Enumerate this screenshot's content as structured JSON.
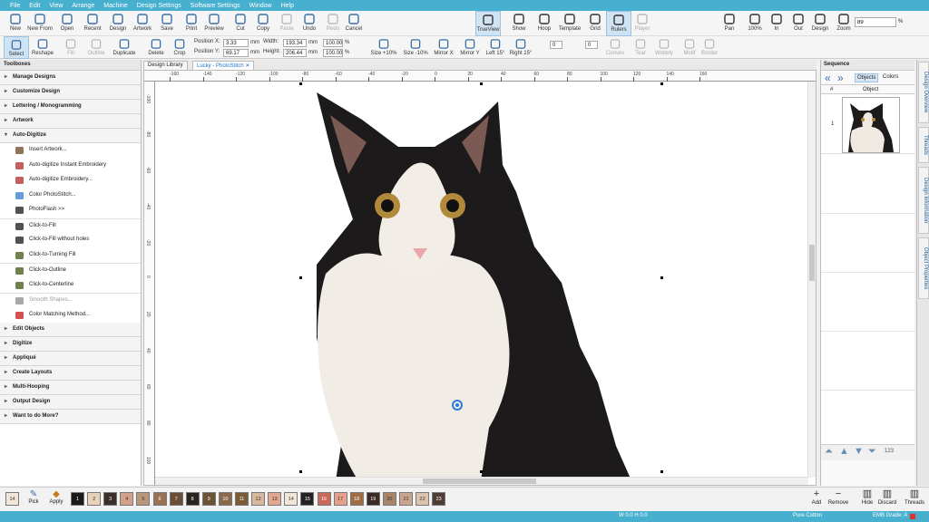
{
  "menu": [
    "File",
    "Edit",
    "View",
    "Arrange",
    "Machine",
    "Design Settings",
    "Software Settings",
    "Window",
    "Help"
  ],
  "toolbar1": {
    "left": [
      {
        "label": "New",
        "icon": "new-file-icon"
      },
      {
        "label": "New From",
        "icon": "new-from-icon"
      },
      {
        "label": "Open",
        "icon": "open-folder-icon"
      },
      {
        "label": "Recent",
        "icon": "recent-icon"
      },
      {
        "label": "Design",
        "icon": "design-icon"
      },
      {
        "label": "Artwork",
        "icon": "artwork-icon"
      },
      {
        "label": "Save",
        "icon": "save-icon"
      },
      {
        "label": "Print",
        "icon": "print-icon"
      },
      {
        "label": "Preview",
        "icon": "preview-icon"
      },
      {
        "label": "Cut",
        "icon": "scissors-icon"
      },
      {
        "label": "Copy",
        "icon": "copy-icon"
      },
      {
        "label": "Paste",
        "icon": "paste-icon"
      },
      {
        "label": "Undo",
        "icon": "undo-icon"
      },
      {
        "label": "Redo",
        "icon": "redo-icon"
      },
      {
        "label": "Cancel",
        "icon": "esc-icon"
      }
    ],
    "center": [
      {
        "label": "TrueView",
        "icon": "eye-icon"
      },
      {
        "label": "Show",
        "icon": "show-icon"
      },
      {
        "label": "Hoop",
        "icon": "hoop-icon"
      },
      {
        "label": "Template",
        "icon": "template-icon"
      },
      {
        "label": "Grid",
        "icon": "grid-icon"
      },
      {
        "label": "Rulers",
        "icon": "rulers-icon"
      },
      {
        "label": "Player",
        "icon": "player-icon"
      }
    ],
    "right": [
      {
        "label": "Pan",
        "icon": "hand-icon"
      },
      {
        "label": "100%",
        "icon": "zoom-100-icon"
      },
      {
        "label": "In",
        "icon": "zoom-in-icon"
      },
      {
        "label": "Out",
        "icon": "zoom-out-icon"
      },
      {
        "label": "Design",
        "icon": "zoom-design-icon"
      },
      {
        "label": "Zoom",
        "icon": "zoom-box-icon"
      }
    ],
    "zoom_value": "89",
    "zoom_unit": "%"
  },
  "toolbar2": {
    "buttons": [
      "Select",
      "Reshape",
      "Fill",
      "Outline",
      "Duplicate",
      "Delete",
      "Crop"
    ],
    "position_x_label": "Position X:",
    "position_x": "3.33",
    "position_y_label": "Position Y:",
    "position_y": "69.17",
    "width_label": "Width:",
    "width": "193.34",
    "height_label": "Height:",
    "height": "206.44",
    "unit": "mm",
    "scale_x": "100.00",
    "scale_y": "100.00",
    "pct": "%",
    "buttons2": [
      "Size +10%",
      "Size -10%",
      "Mirror X",
      "Mirror Y",
      "Left 15°",
      "Right 15°"
    ],
    "rot_a": "0",
    "rot_b": "0",
    "buttons3": [
      "Convex",
      "Tear",
      "Wobbly",
      "Motif",
      "Border"
    ]
  },
  "toolbox": {
    "title": "Toolboxes",
    "sections_top": [
      "Manage Designs",
      "Customize Design",
      "Lettering / Monogramming",
      "Artwork"
    ],
    "open_section": "Auto-Digitize",
    "items": [
      {
        "label": "Insert Artwork...",
        "icon": "insert-artwork-icon",
        "disabled": false
      },
      {
        "label": "Auto-digitize Instant Embroidery",
        "icon": "instant-embroidery-icon",
        "disabled": false
      },
      {
        "label": "Auto-digitize Embroidery...",
        "icon": "auto-digitize-icon",
        "disabled": false
      },
      {
        "label": "Color PhotoStitch...",
        "icon": "photostitch-icon",
        "disabled": false
      },
      {
        "label": "PhotoFlash >>",
        "icon": "camera-icon",
        "disabled": false
      },
      {
        "label": "Click-to-Fill",
        "icon": "click-fill-icon",
        "disabled": false
      },
      {
        "label": "Click-to-Fill without holes",
        "icon": "click-fill-noholes-icon",
        "disabled": false
      },
      {
        "label": "Click-to-Turning Fill",
        "icon": "turning-fill-icon",
        "disabled": false
      },
      {
        "label": "Click-to-Outline",
        "icon": "click-outline-icon",
        "disabled": false
      },
      {
        "label": "Click-to-Centerline",
        "icon": "click-centerline-icon",
        "disabled": false
      },
      {
        "label": "Smooth Shapes...",
        "icon": "smooth-shapes-icon",
        "disabled": true
      },
      {
        "label": "Color Matching Method...",
        "icon": "color-matching-icon",
        "disabled": false
      }
    ],
    "sections_bottom": [
      "Edit Objects",
      "Digitize",
      "Appliqué",
      "Create Layouts",
      "Multi-Hooping",
      "Output Design",
      "Want to do More?"
    ]
  },
  "doc_tabs": [
    "Design Library",
    "Lucky - PhotoStitch"
  ],
  "ruler_top": [
    "-160",
    "-140",
    "-120",
    "-100",
    "-80",
    "-60",
    "-40",
    "-20",
    "0",
    "20",
    "40",
    "60",
    "80",
    "100",
    "120",
    "140",
    "160"
  ],
  "ruler_left": [
    "-100",
    "-80",
    "-60",
    "-40",
    "-20",
    "0",
    "20",
    "40",
    "60",
    "80",
    "100"
  ],
  "sequence": {
    "title": "Sequence",
    "tab_objects": "Objects",
    "tab_colors": "Colors",
    "col_num": "#",
    "col_object": "Object",
    "rows": [
      {
        "num": "1"
      }
    ],
    "page_count": "123"
  },
  "side_tabs": [
    "Design Overview",
    "Threads",
    "Design Information",
    "Object Properties"
  ],
  "palette": {
    "first": "14",
    "pick_label": "Pick",
    "apply_label": "Apply",
    "swatches": [
      {
        "n": "1",
        "c": "#1a1a1a"
      },
      {
        "n": "2",
        "c": "#e9d2ba"
      },
      {
        "n": "3",
        "c": "#3a2f2b"
      },
      {
        "n": "4",
        "c": "#d3a08a"
      },
      {
        "n": "5",
        "c": "#b8977c"
      },
      {
        "n": "6",
        "c": "#9a7252"
      },
      {
        "n": "7",
        "c": "#6b4c35"
      },
      {
        "n": "8",
        "c": "#2a2420"
      },
      {
        "n": "9",
        "c": "#6a5235"
      },
      {
        "n": "10",
        "c": "#8a6a4a"
      },
      {
        "n": "11",
        "c": "#7c5a38"
      },
      {
        "n": "12",
        "c": "#d8b79c"
      },
      {
        "n": "13",
        "c": "#e2a78f"
      },
      {
        "n": "14",
        "c": "#f1e6d8"
      },
      {
        "n": "15",
        "c": "#232020"
      },
      {
        "n": "16",
        "c": "#c76a5a"
      },
      {
        "n": "17",
        "c": "#e6a08c"
      },
      {
        "n": "18",
        "c": "#a06c44"
      },
      {
        "n": "19",
        "c": "#3b2b24"
      },
      {
        "n": "20",
        "c": "#a9856a"
      },
      {
        "n": "21",
        "c": "#c9a58f"
      },
      {
        "n": "22",
        "c": "#dcc3ae"
      },
      {
        "n": "23",
        "c": "#4d3d33"
      }
    ],
    "actions": [
      "Add",
      "Remove",
      "Hide",
      "Discard",
      "Threads"
    ]
  },
  "status": {
    "coords": "W  0.0 H  0.0",
    "fabric": "Pure Cotton",
    "grade": "EMB Grade: A"
  },
  "colors": {
    "accent": "#48b0cf"
  }
}
